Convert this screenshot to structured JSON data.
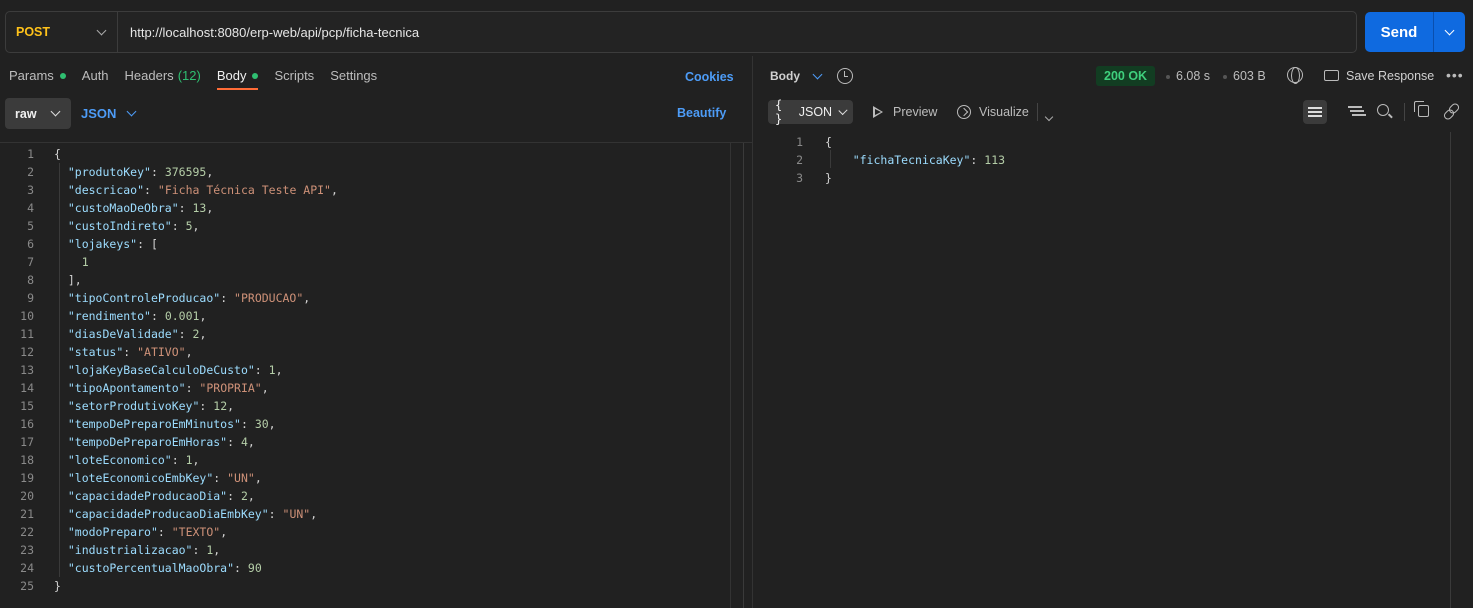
{
  "request": {
    "method": "POST",
    "url": "http://localhost:8080/erp-web/api/pcp/ficha-tecnica",
    "send_label": "Send"
  },
  "request_tabs": {
    "params": "Params",
    "auth": "Auth",
    "headers": "Headers",
    "headers_count": "(12)",
    "body": "Body",
    "scripts": "Scripts",
    "settings": "Settings",
    "cookies": "Cookies"
  },
  "body_options": {
    "mode": "raw",
    "format": "JSON",
    "beautify": "Beautify"
  },
  "request_body": [
    {
      "n": "1",
      "text": "{"
    },
    {
      "n": "2",
      "key": "\"produtoKey\"",
      "val": "376595",
      "vtype": "n",
      "tail": ","
    },
    {
      "n": "3",
      "key": "\"descricao\"",
      "val": "\"Ficha Técnica Teste API\"",
      "vtype": "s",
      "tail": ","
    },
    {
      "n": "4",
      "key": "\"custoMaoDeObra\"",
      "val": "13",
      "vtype": "n",
      "tail": ","
    },
    {
      "n": "5",
      "key": "\"custoIndireto\"",
      "val": "5",
      "vtype": "n",
      "tail": ","
    },
    {
      "n": "6",
      "key": "\"lojakeys\"",
      "val": "[",
      "vtype": "p",
      "tail": ""
    },
    {
      "n": "7",
      "indent": "    ",
      "num": "1"
    },
    {
      "n": "8",
      "indent": "  ",
      "text": "],"
    },
    {
      "n": "9",
      "key": "\"tipoControleProducao\"",
      "val": "\"PRODUCAO\"",
      "vtype": "s",
      "tail": ","
    },
    {
      "n": "10",
      "key": "\"rendimento\"",
      "val": "0.001",
      "vtype": "n",
      "tail": ","
    },
    {
      "n": "11",
      "key": "\"diasDeValidade\"",
      "val": "2",
      "vtype": "n",
      "tail": ","
    },
    {
      "n": "12",
      "key": "\"status\"",
      "val": "\"ATIVO\"",
      "vtype": "s",
      "tail": ","
    },
    {
      "n": "13",
      "key": "\"lojaKeyBaseCalculoDeCusto\"",
      "val": "1",
      "vtype": "n",
      "tail": ","
    },
    {
      "n": "14",
      "key": "\"tipoApontamento\"",
      "val": "\"PROPRIA\"",
      "vtype": "s",
      "tail": ","
    },
    {
      "n": "15",
      "key": "\"setorProdutivoKey\"",
      "val": "12",
      "vtype": "n",
      "tail": ","
    },
    {
      "n": "16",
      "key": "\"tempoDePreparoEmMinutos\"",
      "val": "30",
      "vtype": "n",
      "tail": ","
    },
    {
      "n": "17",
      "key": "\"tempoDePreparoEmHoras\"",
      "val": "4",
      "vtype": "n",
      "tail": ","
    },
    {
      "n": "18",
      "key": "\"loteEconomico\"",
      "val": "1",
      "vtype": "n",
      "tail": ","
    },
    {
      "n": "19",
      "key": "\"loteEconomicoEmbKey\"",
      "val": "\"UN\"",
      "vtype": "s",
      "tail": ","
    },
    {
      "n": "20",
      "key": "\"capacidadeProducaoDia\"",
      "val": "2",
      "vtype": "n",
      "tail": ","
    },
    {
      "n": "21",
      "key": "\"capacidadeProducaoDiaEmbKey\"",
      "val": "\"UN\"",
      "vtype": "s",
      "tail": ","
    },
    {
      "n": "22",
      "key": "\"modoPreparo\"",
      "val": "\"TEXTO\"",
      "vtype": "s",
      "tail": ","
    },
    {
      "n": "23",
      "key": "\"industrializacao\"",
      "val": "1",
      "vtype": "n",
      "tail": ","
    },
    {
      "n": "24",
      "key": "\"custoPercentualMaoObra\"",
      "val": "90",
      "vtype": "n",
      "tail": ""
    },
    {
      "n": "25",
      "text": "}"
    }
  ],
  "response": {
    "body_label": "Body",
    "status": "200 OK",
    "time": "6.08 s",
    "size": "603 B",
    "save_label": "Save Response",
    "format": "JSON",
    "format_icon": "{ }",
    "preview": "Preview",
    "visualize": "Visualize",
    "lines": [
      {
        "n": "1",
        "text": "{"
      },
      {
        "n": "2",
        "key": "\"fichaTecnicaKey\"",
        "val": "113"
      },
      {
        "n": "3",
        "text": "}"
      }
    ]
  },
  "colors": {
    "accent_blue": "#0f6ae0",
    "status_green": "#3fd07d",
    "method_yellow": "#ffc21a",
    "active_tab_orange": "#ff6c37"
  }
}
